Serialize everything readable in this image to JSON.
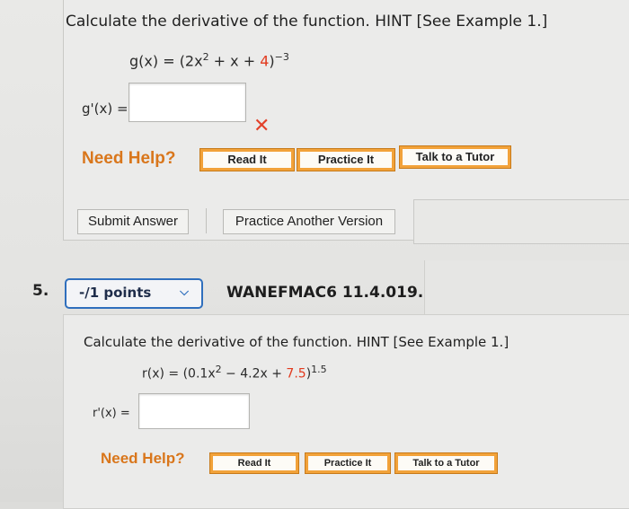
{
  "question1": {
    "prompt": "Calculate the derivative of the function. HINT [See Example 1.]",
    "equation": {
      "lhs": "g(x) = (2x",
      "exp2": "2",
      "mid": " + x + ",
      "red_term": "4",
      "close": ")",
      "power": "−3"
    },
    "answer_label": "g'(x) =",
    "answer_value": "",
    "incorrect_icon": "x-mark-icon",
    "need_help": "Need Help?",
    "help_buttons": [
      "Read It",
      "Practice It",
      "Talk to a Tutor"
    ],
    "submit_label": "Submit Answer",
    "practice_another_label": "Practice Another Version"
  },
  "question2": {
    "number": "5.",
    "points": "-/1 points",
    "chevron_icon": "chevron-down-icon",
    "problem_id": "WANEFMAC6 11.4.019.",
    "prompt": "Calculate the derivative of the function. HINT [See Example 1.]",
    "equation": {
      "lhs": "r(x) = (0.1x",
      "exp2": "2",
      "mid": " − 4.2x + ",
      "red_term": "7.5",
      "close": ")",
      "power": "1.5"
    },
    "answer_label": "r'(x) =",
    "answer_value": "",
    "need_help": "Need Help?",
    "help_buttons": [
      "Read It",
      "Practice It",
      "Talk to a Tutor"
    ]
  },
  "colors": {
    "accent_orange": "#f2a23a",
    "need_help_orange": "#d9761b",
    "red": "#e23a1e",
    "points_blue": "#2f6fbd"
  }
}
